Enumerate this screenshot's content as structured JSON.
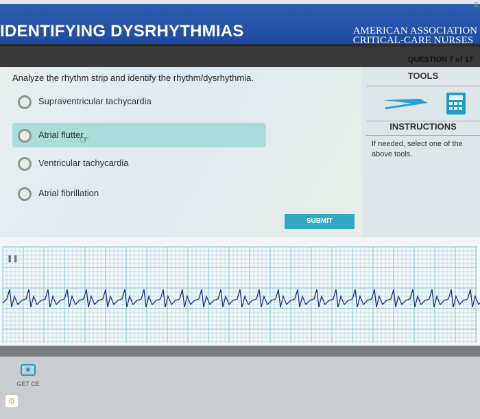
{
  "header": {
    "title": "IDENTIFYING DYSRHYTHMIAS",
    "org_line1": "AMERICAN ASSOCIATION",
    "org_line2": "CRITICAL-CARE NURSES",
    "corner": "E"
  },
  "question": {
    "counter": "QUESTION 7 of 17",
    "prompt": "Analyze the rhythm strip and identify the rhythm/dysrhythmia.",
    "options": [
      {
        "label": "Supraventricular tachycardia",
        "selected": false
      },
      {
        "label": "Atrial flutter",
        "selected": true
      },
      {
        "label": "Ventricular tachycardia",
        "selected": false
      },
      {
        "label": "Atrial fibrillation",
        "selected": false
      }
    ],
    "submit_label": "SUBMIT"
  },
  "sidebar": {
    "tools_heading": "TOOLS",
    "tools": [
      {
        "icon": "calipers-icon"
      },
      {
        "icon": "calculator-icon"
      }
    ],
    "instructions_heading": "INSTRUCTIONS",
    "instructions_text": "If needed, select one of the above tools."
  },
  "strip": {
    "pause_icon": "pause-icon"
  },
  "footer": {
    "get_ce_label": "GET CE",
    "settings_icon": "gear-icon"
  },
  "colors": {
    "header_blue": "#1d4aa0",
    "selected_option": "#a8ddd9",
    "submit": "#2fa8c0",
    "ecg_grid": "#7cc3cf"
  }
}
